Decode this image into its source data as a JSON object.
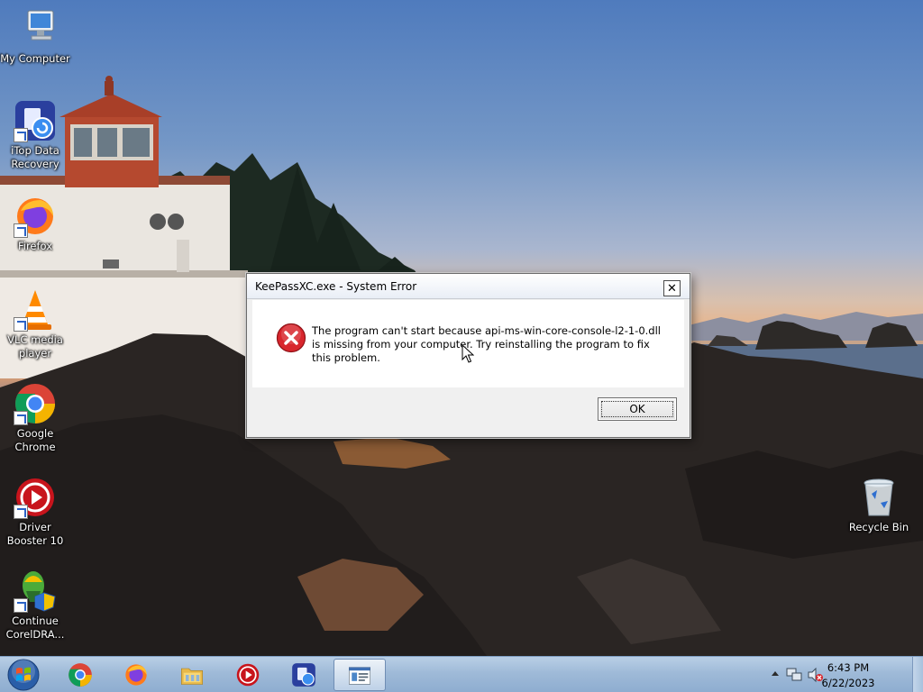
{
  "desktop": {
    "icons": [
      {
        "label": "My Computer",
        "icon": "computer-icon"
      },
      {
        "label": "iTop Data Recovery",
        "icon": "data-recovery-icon"
      },
      {
        "label": "Firefox",
        "icon": "firefox-icon"
      },
      {
        "label": "VLC media player",
        "icon": "vlc-icon"
      },
      {
        "label": "Google Chrome",
        "icon": "chrome-icon"
      },
      {
        "label": "Driver Booster 10",
        "icon": "driver-booster-icon"
      },
      {
        "label": "Continue CorelDRA...",
        "icon": "coreldraw-icon"
      },
      {
        "label": "Recycle Bin",
        "icon": "recycle-bin-icon"
      }
    ]
  },
  "dialog": {
    "title": "KeePassXC.exe - System Error",
    "close_glyph": "✕",
    "message": "The program can't start because api-ms-win-core-console-l2-1-0.dll is missing from your computer. Try reinstalling the program to fix this problem.",
    "ok_label": "OK",
    "icon": "error-icon"
  },
  "taskbar": {
    "start_icon": "windows-start-icon",
    "pinned": [
      "chrome-icon",
      "firefox-icon",
      "file-explorer-icon",
      "driver-booster-icon",
      "data-recovery-icon",
      "dialog-window-icon"
    ],
    "active_index": 5,
    "tray": {
      "icons": [
        "show-hidden-icons-icon",
        "network-icon",
        "volume-muted-icon"
      ],
      "time": "6:43 PM",
      "date": "6/22/2023"
    }
  },
  "colors": {
    "error_red": "#d8262d",
    "taskbar": "#9fbad8"
  }
}
